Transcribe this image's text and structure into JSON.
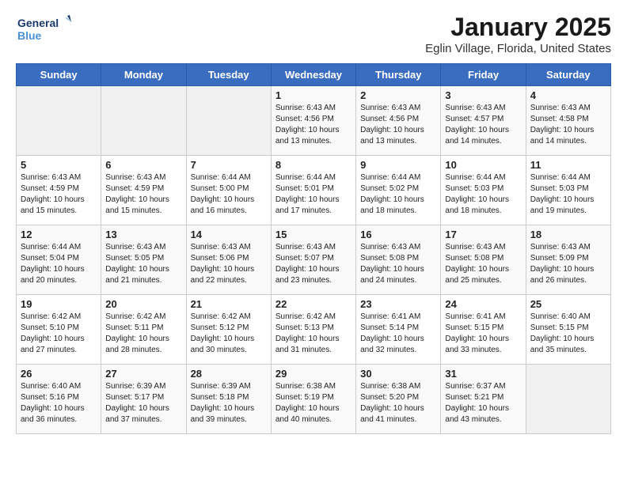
{
  "header": {
    "logo_line1": "General",
    "logo_line2": "Blue",
    "title": "January 2025",
    "subtitle": "Eglin Village, Florida, United States"
  },
  "weekdays": [
    "Sunday",
    "Monday",
    "Tuesday",
    "Wednesday",
    "Thursday",
    "Friday",
    "Saturday"
  ],
  "weeks": [
    [
      {
        "day": "",
        "info": ""
      },
      {
        "day": "",
        "info": ""
      },
      {
        "day": "",
        "info": ""
      },
      {
        "day": "1",
        "info": "Sunrise: 6:43 AM\nSunset: 4:56 PM\nDaylight: 10 hours\nand 13 minutes."
      },
      {
        "day": "2",
        "info": "Sunrise: 6:43 AM\nSunset: 4:56 PM\nDaylight: 10 hours\nand 13 minutes."
      },
      {
        "day": "3",
        "info": "Sunrise: 6:43 AM\nSunset: 4:57 PM\nDaylight: 10 hours\nand 14 minutes."
      },
      {
        "day": "4",
        "info": "Sunrise: 6:43 AM\nSunset: 4:58 PM\nDaylight: 10 hours\nand 14 minutes."
      }
    ],
    [
      {
        "day": "5",
        "info": "Sunrise: 6:43 AM\nSunset: 4:59 PM\nDaylight: 10 hours\nand 15 minutes."
      },
      {
        "day": "6",
        "info": "Sunrise: 6:43 AM\nSunset: 4:59 PM\nDaylight: 10 hours\nand 15 minutes."
      },
      {
        "day": "7",
        "info": "Sunrise: 6:44 AM\nSunset: 5:00 PM\nDaylight: 10 hours\nand 16 minutes."
      },
      {
        "day": "8",
        "info": "Sunrise: 6:44 AM\nSunset: 5:01 PM\nDaylight: 10 hours\nand 17 minutes."
      },
      {
        "day": "9",
        "info": "Sunrise: 6:44 AM\nSunset: 5:02 PM\nDaylight: 10 hours\nand 18 minutes."
      },
      {
        "day": "10",
        "info": "Sunrise: 6:44 AM\nSunset: 5:03 PM\nDaylight: 10 hours\nand 18 minutes."
      },
      {
        "day": "11",
        "info": "Sunrise: 6:44 AM\nSunset: 5:03 PM\nDaylight: 10 hours\nand 19 minutes."
      }
    ],
    [
      {
        "day": "12",
        "info": "Sunrise: 6:44 AM\nSunset: 5:04 PM\nDaylight: 10 hours\nand 20 minutes."
      },
      {
        "day": "13",
        "info": "Sunrise: 6:43 AM\nSunset: 5:05 PM\nDaylight: 10 hours\nand 21 minutes."
      },
      {
        "day": "14",
        "info": "Sunrise: 6:43 AM\nSunset: 5:06 PM\nDaylight: 10 hours\nand 22 minutes."
      },
      {
        "day": "15",
        "info": "Sunrise: 6:43 AM\nSunset: 5:07 PM\nDaylight: 10 hours\nand 23 minutes."
      },
      {
        "day": "16",
        "info": "Sunrise: 6:43 AM\nSunset: 5:08 PM\nDaylight: 10 hours\nand 24 minutes."
      },
      {
        "day": "17",
        "info": "Sunrise: 6:43 AM\nSunset: 5:08 PM\nDaylight: 10 hours\nand 25 minutes."
      },
      {
        "day": "18",
        "info": "Sunrise: 6:43 AM\nSunset: 5:09 PM\nDaylight: 10 hours\nand 26 minutes."
      }
    ],
    [
      {
        "day": "19",
        "info": "Sunrise: 6:42 AM\nSunset: 5:10 PM\nDaylight: 10 hours\nand 27 minutes."
      },
      {
        "day": "20",
        "info": "Sunrise: 6:42 AM\nSunset: 5:11 PM\nDaylight: 10 hours\nand 28 minutes."
      },
      {
        "day": "21",
        "info": "Sunrise: 6:42 AM\nSunset: 5:12 PM\nDaylight: 10 hours\nand 30 minutes."
      },
      {
        "day": "22",
        "info": "Sunrise: 6:42 AM\nSunset: 5:13 PM\nDaylight: 10 hours\nand 31 minutes."
      },
      {
        "day": "23",
        "info": "Sunrise: 6:41 AM\nSunset: 5:14 PM\nDaylight: 10 hours\nand 32 minutes."
      },
      {
        "day": "24",
        "info": "Sunrise: 6:41 AM\nSunset: 5:15 PM\nDaylight: 10 hours\nand 33 minutes."
      },
      {
        "day": "25",
        "info": "Sunrise: 6:40 AM\nSunset: 5:15 PM\nDaylight: 10 hours\nand 35 minutes."
      }
    ],
    [
      {
        "day": "26",
        "info": "Sunrise: 6:40 AM\nSunset: 5:16 PM\nDaylight: 10 hours\nand 36 minutes."
      },
      {
        "day": "27",
        "info": "Sunrise: 6:39 AM\nSunset: 5:17 PM\nDaylight: 10 hours\nand 37 minutes."
      },
      {
        "day": "28",
        "info": "Sunrise: 6:39 AM\nSunset: 5:18 PM\nDaylight: 10 hours\nand 39 minutes."
      },
      {
        "day": "29",
        "info": "Sunrise: 6:38 AM\nSunset: 5:19 PM\nDaylight: 10 hours\nand 40 minutes."
      },
      {
        "day": "30",
        "info": "Sunrise: 6:38 AM\nSunset: 5:20 PM\nDaylight: 10 hours\nand 41 minutes."
      },
      {
        "day": "31",
        "info": "Sunrise: 6:37 AM\nSunset: 5:21 PM\nDaylight: 10 hours\nand 43 minutes."
      },
      {
        "day": "",
        "info": ""
      }
    ]
  ]
}
